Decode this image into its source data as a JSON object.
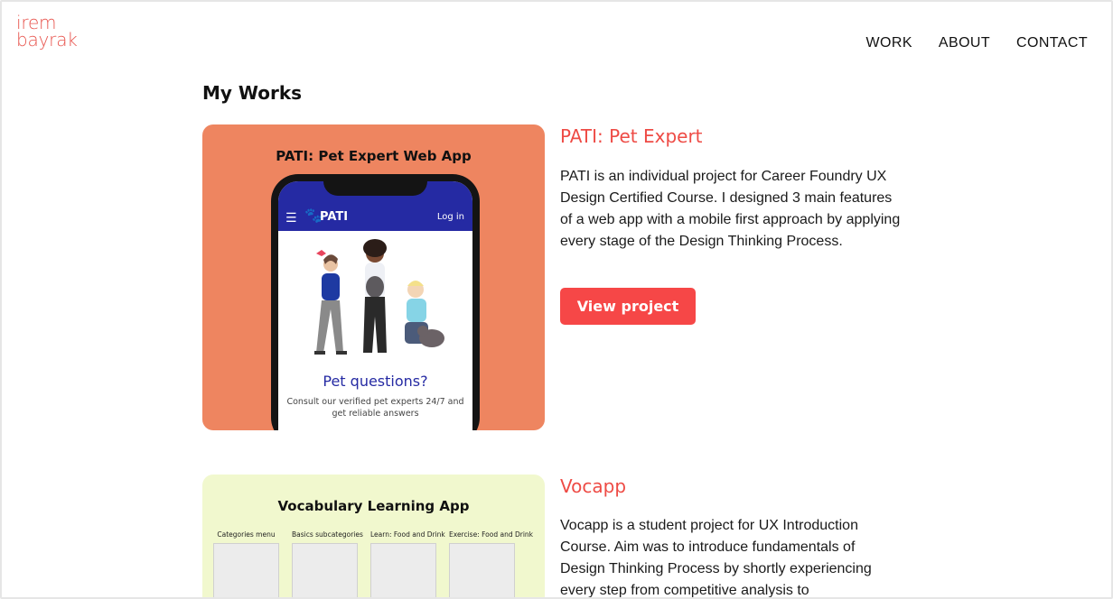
{
  "logo": {
    "line1": "irem",
    "line2": "bayrak"
  },
  "nav": {
    "items": [
      "WORK",
      "ABOUT",
      "CONTACT"
    ]
  },
  "page_title": "My Works",
  "projects": [
    {
      "title": "PATI: Pet Expert",
      "description": "PATI is an individual project for Career Foundry UX Design Certified Course. I designed 3 main features of a web app with a mobile first approach by applying every stage of the Design Thinking Process.",
      "button": "View project",
      "image": {
        "heading": "PATI: Pet Expert Web App",
        "brand": "PATI",
        "login": "Log in",
        "menu_icon": "hamburger-icon",
        "brand_icon": "paw-icon",
        "headline": "Pet questions?",
        "subtext": "Consult our verified pet experts 24/7 and get reliable answers",
        "bg_color": "#ee8560",
        "app_bar_color": "#252aa3"
      }
    },
    {
      "title": "Vocapp",
      "description": "Vocapp is a student project for UX Introduction Course. Aim was to introduce fundamentals of Design Thinking Process by shortly experiencing every step from competitive analysis to",
      "image": {
        "heading": "Vocabulary Learning App",
        "columns": [
          "Categories menu",
          "Basics subcategories",
          "Learn: Food and Drink",
          "Exercise: Food and Drink"
        ],
        "bg_color": "#f1f8ce"
      }
    }
  ],
  "colors": {
    "accent": "#ee4b45",
    "button": "#f64747",
    "logo": "#e8554e"
  }
}
